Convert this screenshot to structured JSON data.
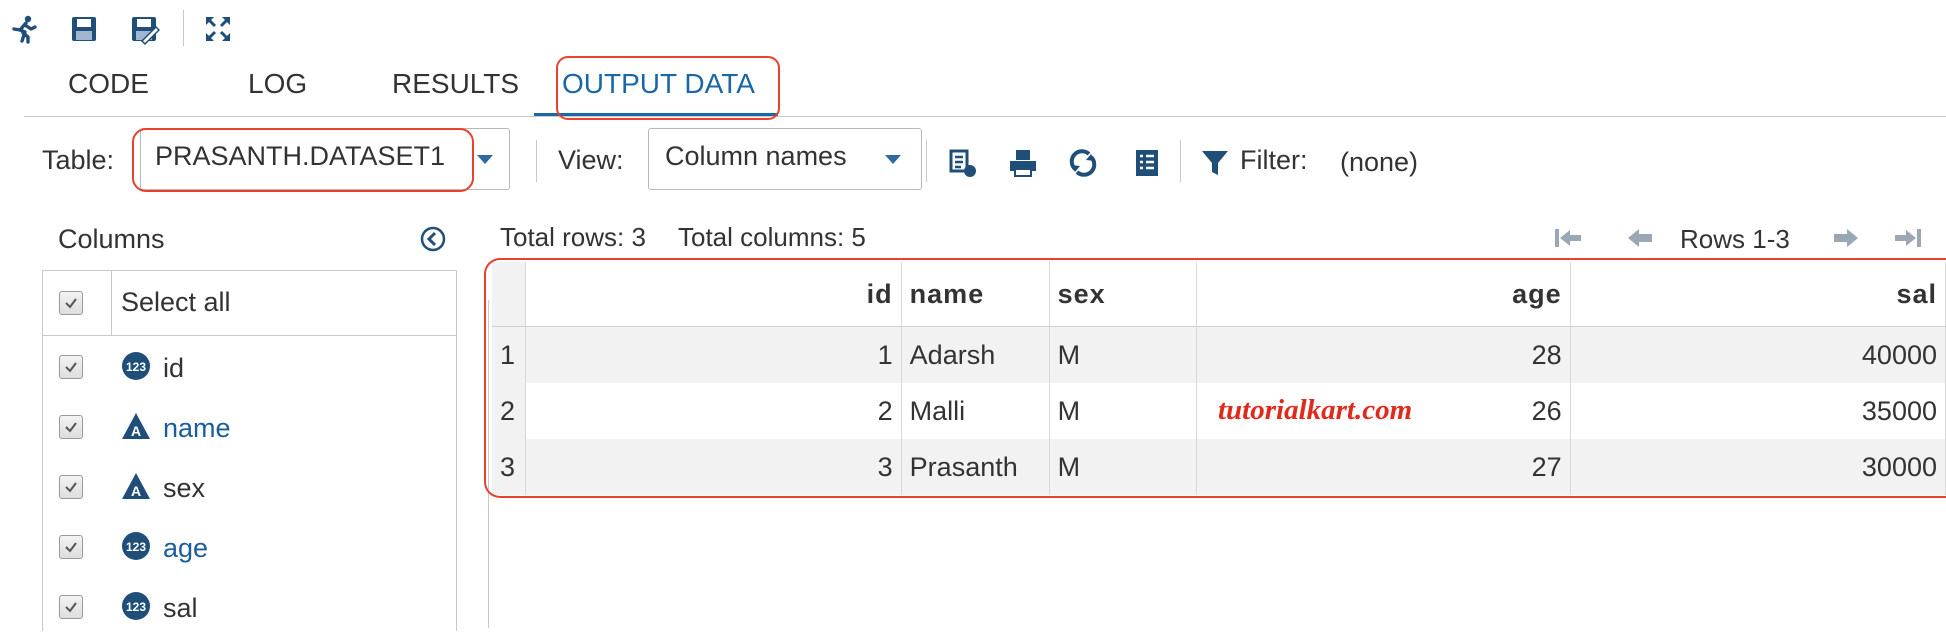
{
  "top_toolbar": {
    "icons": [
      "run-icon",
      "save-icon",
      "save-as-icon",
      "maximize-icon"
    ]
  },
  "tabs": [
    {
      "label": "CODE",
      "active": false
    },
    {
      "label": "LOG",
      "active": false
    },
    {
      "label": "RESULTS",
      "active": false
    },
    {
      "label": "OUTPUT DATA",
      "active": true
    }
  ],
  "toolbar": {
    "table_label": "Table:",
    "table_value": "PRASANTH.DATASET1",
    "view_label": "View:",
    "view_value": "Column names",
    "icons": [
      "export-icon",
      "print-icon",
      "refresh-icon",
      "properties-icon",
      "filter-icon"
    ],
    "filter_label": "Filter:",
    "filter_value": "(none)"
  },
  "columns_panel": {
    "title": "Columns",
    "select_all_label": "Select all",
    "items": [
      {
        "name": "id",
        "type": "numeric",
        "checked": true,
        "link": false
      },
      {
        "name": "name",
        "type": "character",
        "checked": true,
        "link": true
      },
      {
        "name": "sex",
        "type": "character",
        "checked": true,
        "link": false
      },
      {
        "name": "age",
        "type": "numeric",
        "checked": true,
        "link": true
      },
      {
        "name": "sal",
        "type": "numeric",
        "checked": true,
        "link": false
      }
    ]
  },
  "grid": {
    "total_rows": "Total rows: 3",
    "total_columns": "Total columns: 5",
    "rows_range": "Rows 1-3",
    "headers": [
      "id",
      "name",
      "sex",
      "age",
      "sal"
    ],
    "rows": [
      {
        "num": "1",
        "id": "1",
        "name": "Adarsh",
        "sex": "M",
        "age": "28",
        "sal": "40000"
      },
      {
        "num": "2",
        "id": "2",
        "name": "Malli",
        "sex": "M",
        "age": "26",
        "sal": "35000"
      },
      {
        "num": "3",
        "id": "3",
        "name": "Prasanth",
        "sex": "M",
        "age": "27",
        "sal": "30000"
      }
    ]
  },
  "watermark": "tutorialkart.com",
  "colors": {
    "accent": "#1a67a8",
    "highlight": "#e8412c",
    "watermark": "#e02a1c",
    "icon": "#1f4e79"
  }
}
